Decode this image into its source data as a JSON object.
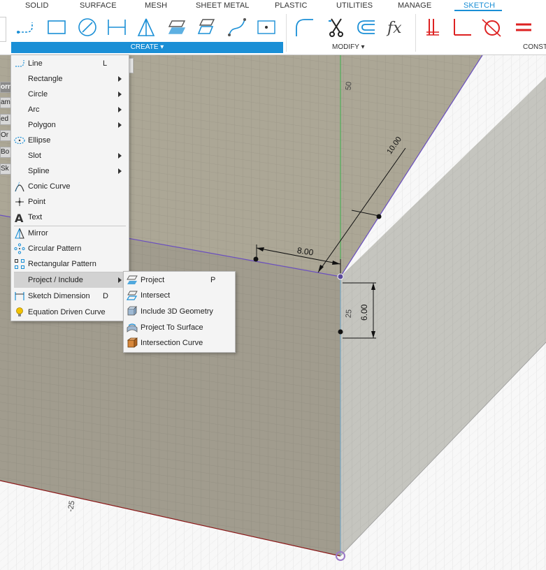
{
  "tabs": [
    {
      "label": "SOLID"
    },
    {
      "label": "SURFACE"
    },
    {
      "label": "MESH"
    },
    {
      "label": "SHEET METAL"
    },
    {
      "label": "PLASTIC"
    },
    {
      "label": "UTILITIES"
    },
    {
      "label": "MANAGE"
    },
    {
      "label": "SKETCH",
      "active": true
    }
  ],
  "toolbar": {
    "create_label": "CREATE ▾",
    "modify_label": "MODIFY ▾",
    "constraints_label": "CONST",
    "accent": "#1a8fd6"
  },
  "browser": {
    "tags": [
      "orn",
      "ame",
      "ed Y",
      "Or",
      "Bo",
      "Sk"
    ]
  },
  "create_menu": {
    "items": [
      {
        "label": "Line",
        "shortcut": "L",
        "icon": "line-icon"
      },
      {
        "label": "Rectangle",
        "submenu": true
      },
      {
        "label": "Circle",
        "submenu": true
      },
      {
        "label": "Arc",
        "submenu": true
      },
      {
        "label": "Polygon",
        "submenu": true
      },
      {
        "label": "Ellipse",
        "icon": "ellipse-icon"
      },
      {
        "label": "Slot",
        "submenu": true
      },
      {
        "label": "Spline",
        "submenu": true
      },
      {
        "label": "Conic Curve",
        "icon": "conic-curve-icon"
      },
      {
        "label": "Point",
        "icon": "point-icon"
      },
      {
        "label": "Text",
        "icon": "text-icon"
      },
      {
        "label": "Mirror",
        "icon": "mirror-icon"
      },
      {
        "label": "Circular Pattern",
        "icon": "circular-pattern-icon"
      },
      {
        "label": "Rectangular Pattern",
        "icon": "rectangular-pattern-icon"
      },
      {
        "label": "Project / Include",
        "submenu": true,
        "highlighted": true
      },
      {
        "label": "Sketch Dimension",
        "shortcut": "D",
        "icon": "sketch-dimension-icon"
      },
      {
        "label": "Equation Driven Curve",
        "icon": "lightbulb-icon"
      }
    ]
  },
  "project_submenu": {
    "items": [
      {
        "label": "Project",
        "shortcut": "P",
        "icon": "project-icon"
      },
      {
        "label": "Intersect",
        "icon": "intersect-icon"
      },
      {
        "label": "Include 3D Geometry",
        "icon": "include-3d-geometry-icon"
      },
      {
        "label": "Project To Surface",
        "icon": "project-to-surface-icon"
      },
      {
        "label": "Intersection Curve",
        "icon": "intersection-curve-icon"
      }
    ]
  },
  "viewport": {
    "dim_width": "8.00",
    "dim_depth": "10.00",
    "dim_height": "6.00",
    "axis_label_top": "50",
    "axis_label_mid": "25",
    "axis_label_left": "-25"
  }
}
